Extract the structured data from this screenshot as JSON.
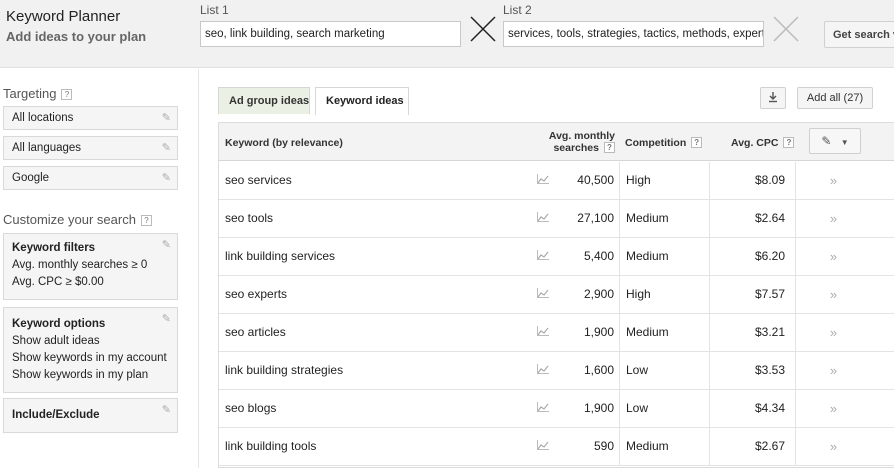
{
  "header": {
    "title": "Keyword Planner",
    "subtitle": "Add ideas to your plan",
    "list1_label": "List 1",
    "list1_value": "seo, link building, search marketing",
    "list2_label": "List 2",
    "list2_value": "services, tools, strategies, tactics, methods, experts",
    "get_search_label": "Get search v"
  },
  "sidebar": {
    "targeting_label": "Targeting",
    "targeting_help": "?",
    "locations": "All locations",
    "languages": "All languages",
    "network": "Google",
    "customize_label": "Customize your search",
    "customize_help": "?",
    "filters_title": "Keyword filters",
    "filter_1": "Avg. monthly searches ≥ 0",
    "filter_2": "Avg. CPC ≥ $0.00",
    "options_title": "Keyword options",
    "option_1": "Show adult ideas",
    "option_2": "Show keywords in my account",
    "option_3": "Show keywords in my plan",
    "include_exclude": "Include/Exclude"
  },
  "tabs": [
    {
      "label": "Ad group ideas",
      "active": false
    },
    {
      "label": "Keyword ideas",
      "active": true
    }
  ],
  "toolbar": {
    "download_icon": "download-icon",
    "add_all_label": "Add all (27)"
  },
  "table": {
    "headers": {
      "keyword": "Keyword (by relevance)",
      "volume_line1": "Avg. monthly",
      "volume_line2": "searches",
      "competition": "Competition",
      "cpc": "Avg. CPC",
      "help": "?"
    },
    "rows": [
      {
        "keyword": "seo services",
        "volume": "40,500",
        "competition": "High",
        "cpc": "$8.09"
      },
      {
        "keyword": "seo tools",
        "volume": "27,100",
        "competition": "Medium",
        "cpc": "$2.64"
      },
      {
        "keyword": "link building services",
        "volume": "5,400",
        "competition": "Medium",
        "cpc": "$6.20"
      },
      {
        "keyword": "seo experts",
        "volume": "2,900",
        "competition": "High",
        "cpc": "$7.57"
      },
      {
        "keyword": "seo articles",
        "volume": "1,900",
        "competition": "Medium",
        "cpc": "$3.21"
      },
      {
        "keyword": "link building strategies",
        "volume": "1,600",
        "competition": "Low",
        "cpc": "$3.53"
      },
      {
        "keyword": "seo blogs",
        "volume": "1,900",
        "competition": "Low",
        "cpc": "$4.34"
      },
      {
        "keyword": "link building tools",
        "volume": "590",
        "competition": "Medium",
        "cpc": "$2.67"
      }
    ]
  },
  "colors": {
    "header_bg": "#f1f1f1",
    "inactive_tab_bg": "#eaf1e4",
    "table_header_bg": "#f3f3f3"
  }
}
